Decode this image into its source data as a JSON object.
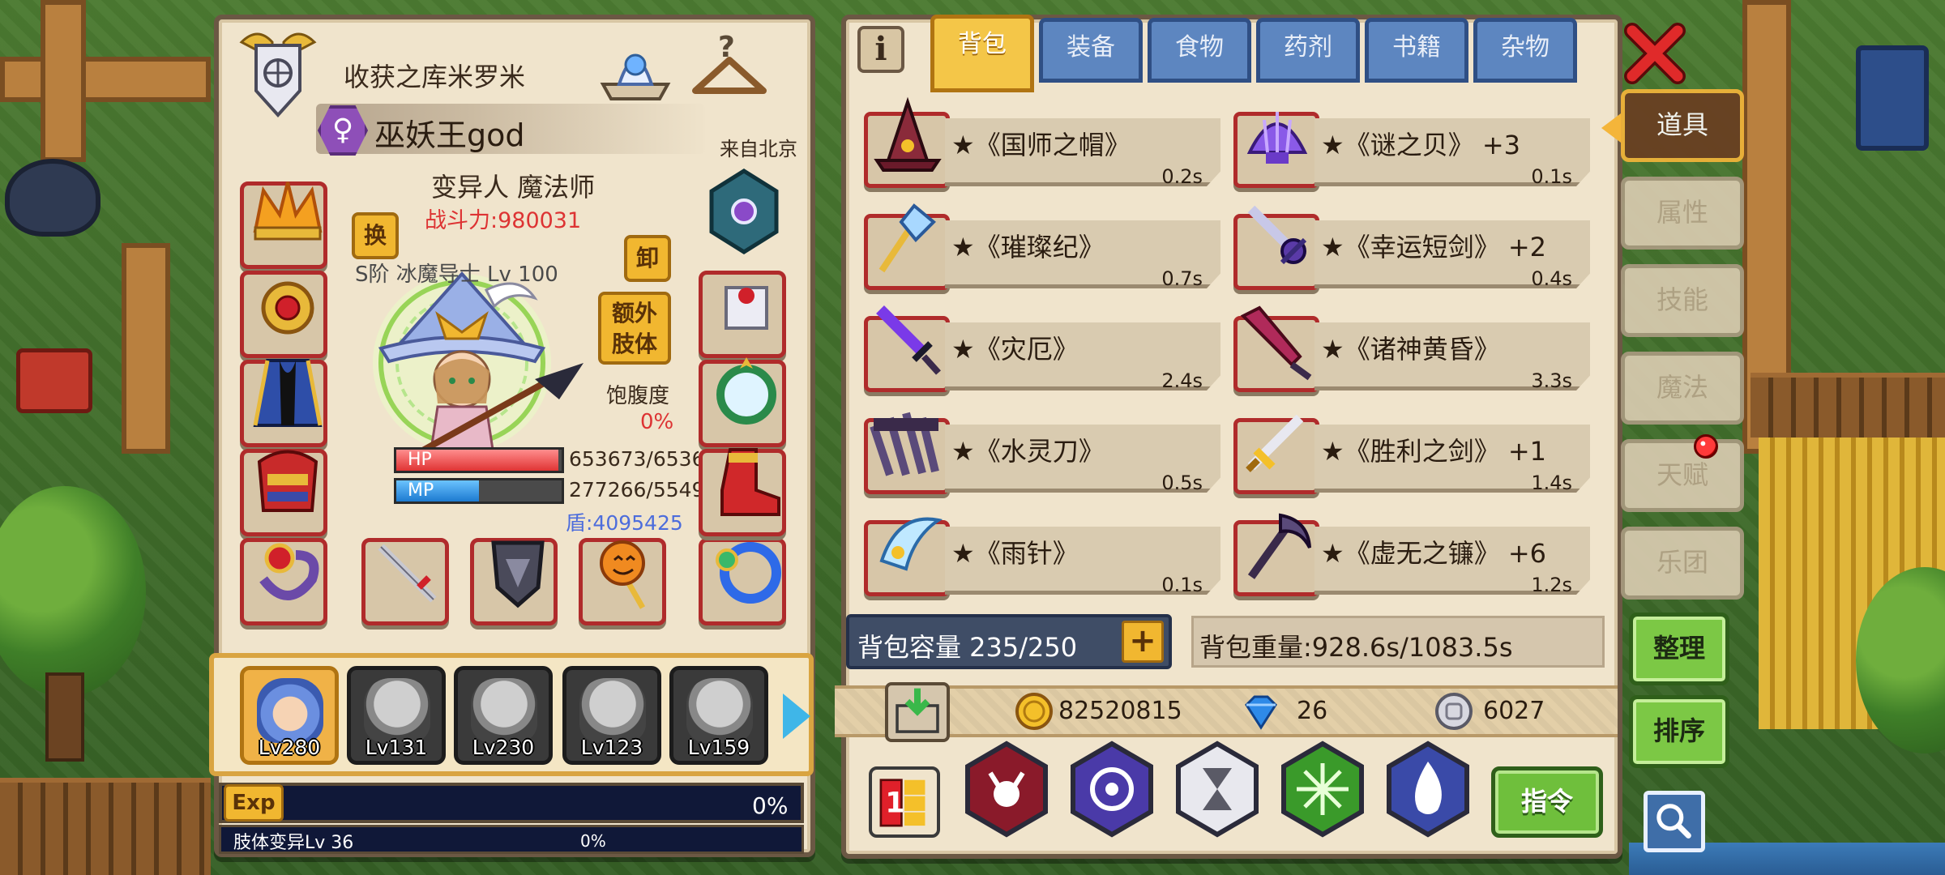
{
  "character": {
    "guild_name": "收获之库米罗米",
    "gender_symbol": "♀",
    "player_name": "巫妖王god",
    "origin": "来自北京",
    "race_class": "变异人 魔法师",
    "power": "战斗力:980031",
    "tier_line": "S阶 冰魔导士 Lv 100",
    "swap_label": "换",
    "unequip_label": "卸",
    "extra_limb_label": "额外肢体",
    "satiety_label": "饱腹度",
    "satiety_value": "0%",
    "satiety_level": 0,
    "hp_label": "HP",
    "hp_value": "653673/6536",
    "hp_fraction": 0.98,
    "mp_label": "MP",
    "mp_value": "277266/5549",
    "mp_fraction": 0.5,
    "shield": "盾:4095425"
  },
  "party": [
    {
      "level": "Lv280",
      "active": true
    },
    {
      "level": "Lv131",
      "active": false
    },
    {
      "level": "Lv230",
      "active": false
    },
    {
      "level": "Lv123",
      "active": false
    },
    {
      "level": "Lv159",
      "active": false
    }
  ],
  "exp": {
    "tag": "Exp",
    "percent": "0%",
    "limb_label": "肢体变异Lv 36",
    "limb_percent": "0%"
  },
  "tabs": [
    {
      "label": "背包",
      "active": true
    },
    {
      "label": "装备",
      "active": false
    },
    {
      "label": "食物",
      "active": false
    },
    {
      "label": "药剂",
      "active": false
    },
    {
      "label": "书籍",
      "active": false
    },
    {
      "label": "杂物",
      "active": false
    }
  ],
  "info_icon": "i",
  "items": [
    {
      "name": "★《国师之帽》",
      "weight": "0.2s",
      "icon": "wizard-hat-icon"
    },
    {
      "name": "★《谜之贝》 +3",
      "weight": "0.1s",
      "icon": "shell-icon"
    },
    {
      "name": "★《璀璨纪》",
      "weight": "0.7s",
      "icon": "crystal-staff-icon"
    },
    {
      "name": "★《幸运短剑》 +2",
      "weight": "0.4s",
      "icon": "dagger-icon"
    },
    {
      "name": "★《灾厄》",
      "weight": "2.4s",
      "icon": "purple-sword-icon"
    },
    {
      "name": "★《诸神黄昏》",
      "weight": "3.3s",
      "icon": "crimson-blade-icon"
    },
    {
      "name": "★《水灵刀》",
      "weight": "0.5s",
      "icon": "claw-icon"
    },
    {
      "name": "★《胜利之剑》 +1",
      "weight": "1.4s",
      "icon": "gold-sword-icon"
    },
    {
      "name": "★《雨针》",
      "weight": "0.1s",
      "icon": "ice-blade-icon"
    },
    {
      "name": "★《虚无之镰》 +6",
      "weight": "1.2s",
      "icon": "scythe-icon"
    }
  ],
  "bag": {
    "capacity": "背包容量 235/250",
    "plus": "+",
    "weight": "背包重量:928.6s/1083.5s"
  },
  "currency": {
    "gold": "82520815",
    "gems": "26",
    "silver": "6027"
  },
  "order_label": "指令",
  "side_tabs": [
    {
      "label": "道具",
      "active": true
    },
    {
      "label": "属性",
      "active": false
    },
    {
      "label": "技能",
      "active": false
    },
    {
      "label": "魔法",
      "active": false
    },
    {
      "label": "天赋",
      "active": false
    },
    {
      "label": "乐团",
      "active": false
    }
  ],
  "sort_label": "整理",
  "order2_label": "排序",
  "colors": {
    "panel": "#f0e4cc",
    "tab_active": "#f4c648",
    "tab": "#5d86c0",
    "slot_border": "#b02b2b",
    "power_red": "#dd3333",
    "shield_blue": "#4d6ddc"
  }
}
